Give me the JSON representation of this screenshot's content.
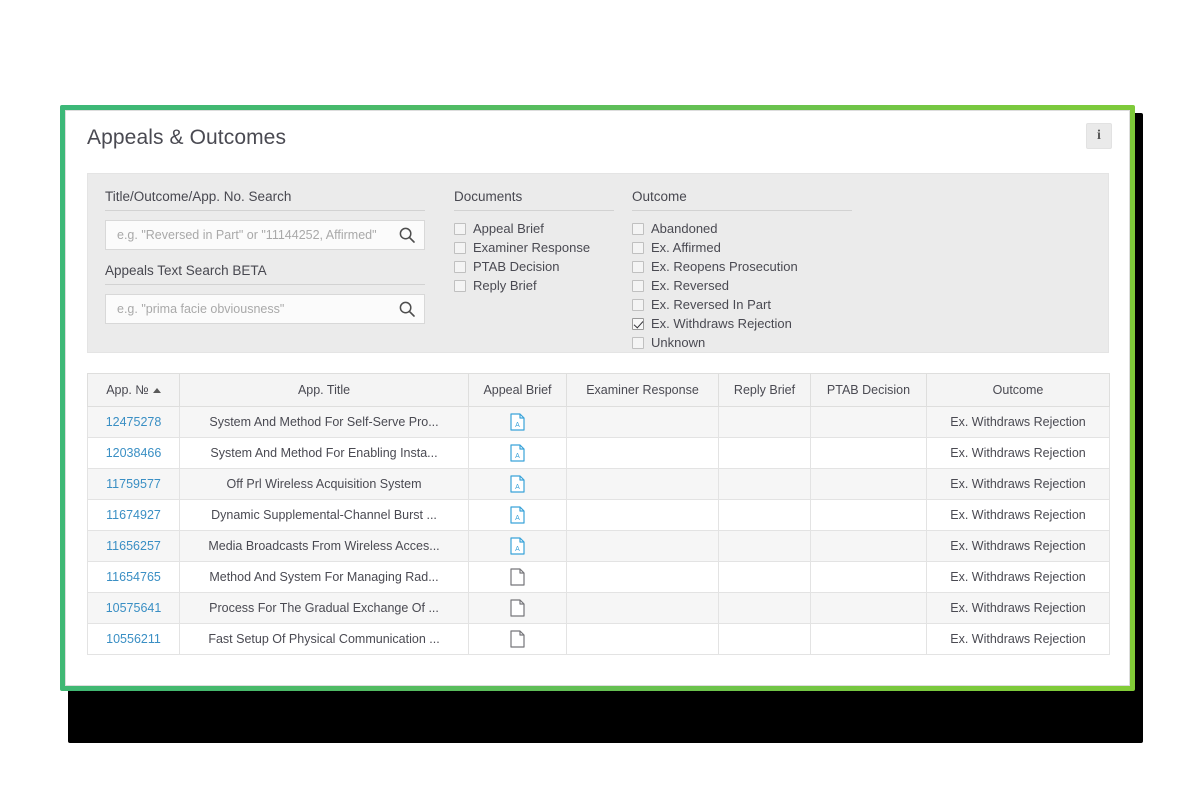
{
  "card": {
    "title": "Appeals & Outcomes",
    "info_button_label": "i",
    "accent_start_color": "#3cb878",
    "accent_end_color": "#82cc37"
  },
  "filters": {
    "search": {
      "label": "Title/Outcome/App. No. Search",
      "value": "",
      "placeholder": "e.g. \"Reversed in Part\" or \"11144252, Affirmed\"",
      "icon": "search-icon"
    },
    "text_search": {
      "label": "Appeals Text Search BETA",
      "value": "",
      "placeholder": "e.g. \"prima facie obviousness\"",
      "icon": "search-icon"
    },
    "documents": {
      "label": "Documents",
      "options": [
        {
          "label": "Appeal Brief",
          "checked": false
        },
        {
          "label": "Examiner Response",
          "checked": false
        },
        {
          "label": "PTAB Decision",
          "checked": false
        },
        {
          "label": "Reply Brief",
          "checked": false
        }
      ]
    },
    "outcome": {
      "label": "Outcome",
      "options": [
        {
          "label": "Abandoned",
          "checked": false
        },
        {
          "label": "Ex. Affirmed",
          "checked": false
        },
        {
          "label": "Ex. Reopens Prosecution",
          "checked": false
        },
        {
          "label": "Ex. Reversed",
          "checked": false
        },
        {
          "label": "Ex. Reversed In Part",
          "checked": false
        },
        {
          "label": "Ex. Withdraws Rejection",
          "checked": true
        },
        {
          "label": "Unknown",
          "checked": false
        }
      ]
    }
  },
  "table": {
    "sort_column": "App. №",
    "sort_direction": "asc",
    "columns": [
      "App. №",
      "App. Title",
      "Appeal Brief",
      "Examiner Response",
      "Reply Brief",
      "PTAB Decision",
      "Outcome"
    ],
    "rows": [
      {
        "app_no": "12475278",
        "title": "System And Method For Self-Serve Pro...",
        "appeal_brief": "pdf-icon",
        "examiner_response": "",
        "reply_brief": "",
        "ptab_decision": "",
        "outcome": "Ex. Withdraws Rejection"
      },
      {
        "app_no": "12038466",
        "title": "System And Method For Enabling Insta...",
        "appeal_brief": "pdf-icon",
        "examiner_response": "",
        "reply_brief": "",
        "ptab_decision": "",
        "outcome": "Ex. Withdraws Rejection"
      },
      {
        "app_no": "11759577",
        "title": "Off Prl Wireless Acquisition System",
        "appeal_brief": "pdf-icon",
        "examiner_response": "",
        "reply_brief": "",
        "ptab_decision": "",
        "outcome": "Ex. Withdraws Rejection"
      },
      {
        "app_no": "11674927",
        "title": "Dynamic Supplemental-Channel Burst ...",
        "appeal_brief": "pdf-icon",
        "examiner_response": "",
        "reply_brief": "",
        "ptab_decision": "",
        "outcome": "Ex. Withdraws Rejection"
      },
      {
        "app_no": "11656257",
        "title": "Media Broadcasts From Wireless Acces...",
        "appeal_brief": "pdf-icon",
        "examiner_response": "",
        "reply_brief": "",
        "ptab_decision": "",
        "outcome": "Ex. Withdraws Rejection"
      },
      {
        "app_no": "11654765",
        "title": "Method And System For Managing Rad...",
        "appeal_brief": "blank-doc-icon",
        "examiner_response": "",
        "reply_brief": "",
        "ptab_decision": "",
        "outcome": "Ex. Withdraws Rejection"
      },
      {
        "app_no": "10575641",
        "title": "Process For The Gradual Exchange Of ...",
        "appeal_brief": "blank-doc-icon",
        "examiner_response": "",
        "reply_brief": "",
        "ptab_decision": "",
        "outcome": "Ex. Withdraws Rejection"
      },
      {
        "app_no": "10556211",
        "title": "Fast Setup Of Physical Communication ...",
        "appeal_brief": "blank-doc-icon",
        "examiner_response": "",
        "reply_brief": "",
        "ptab_decision": "",
        "outcome": "Ex. Withdraws Rejection"
      }
    ]
  }
}
